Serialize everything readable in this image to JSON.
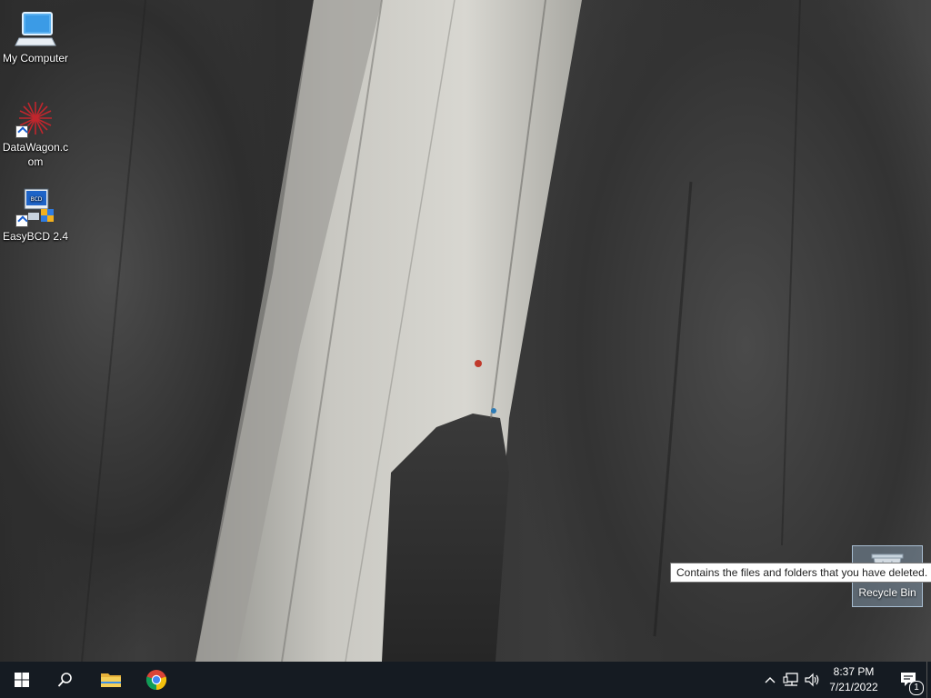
{
  "desktop": {
    "icons": [
      {
        "label": "My Computer",
        "icon": "computer-icon"
      },
      {
        "label": "DataWagon.com",
        "icon": "datawagon-icon"
      },
      {
        "label": "EasyBCD 2.4",
        "icon": "easybcd-icon"
      }
    ],
    "recycle_bin": {
      "label": "Recycle Bin",
      "icon": "recycle-bin-icon"
    },
    "tooltip": "Contains the files and folders that you have deleted."
  },
  "taskbar": {
    "start_icon": "windows-logo-icon",
    "search_icon": "search-icon",
    "pinned": [
      {
        "name": "File Explorer",
        "icon": "folder-icon"
      },
      {
        "name": "Google Chrome",
        "icon": "chrome-icon"
      }
    ],
    "tray": {
      "chevron_icon": "chevron-up-icon",
      "network_icon": "network-icon",
      "volume_icon": "speaker-icon",
      "time": "8:37 PM",
      "date": "7/21/2022",
      "notification_icon": "notification-icon",
      "notification_count": "1"
    }
  }
}
